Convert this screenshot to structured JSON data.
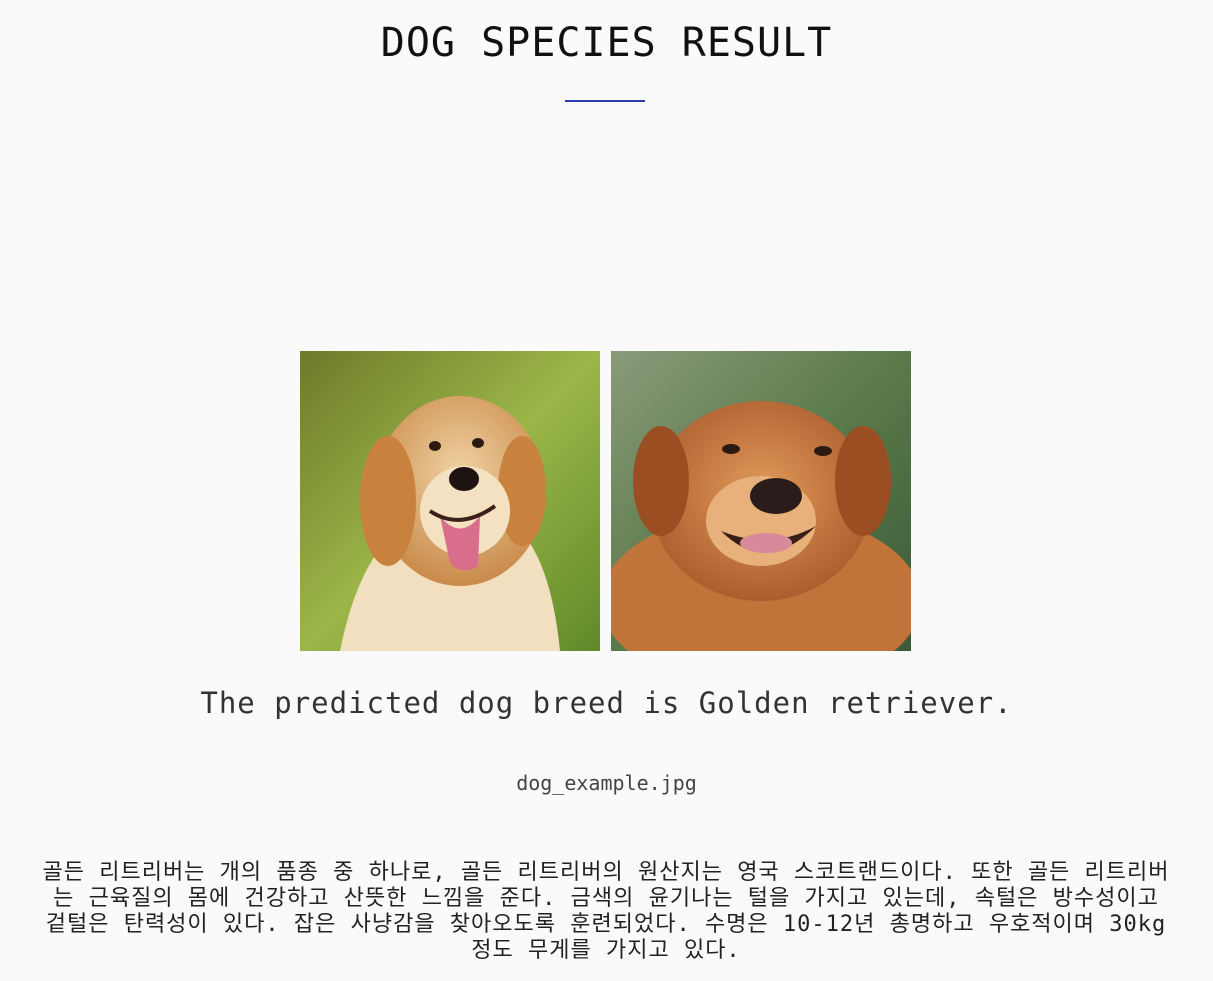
{
  "page": {
    "title": "DOG SPECIES RESULT",
    "accent_color": "#2a3bb0"
  },
  "images": [
    {
      "name": "golden-retriever-photo-1"
    },
    {
      "name": "golden-retriever-photo-2"
    }
  ],
  "result": {
    "prediction_text": "The predicted dog breed is Golden retriever.",
    "filename": "dog_example.jpg",
    "description": "골든 리트리버는 개의 품종 중 하나로, 골든 리트리버의 원산지는 영국 스코트랜드이다. 또한 골든 리트리버는 근육질의 몸에 건강하고 산뜻한 느낌을 준다. 금색의 윤기나는 털을 가지고 있는데, 속털은 방수성이고 겉털은 탄력성이 있다. 잡은 사냥감을 찾아오도록 훈련되었다. 수명은 10-12년 총명하고 우호적이며 30kg 정도 무게를 가지고 있다."
  }
}
